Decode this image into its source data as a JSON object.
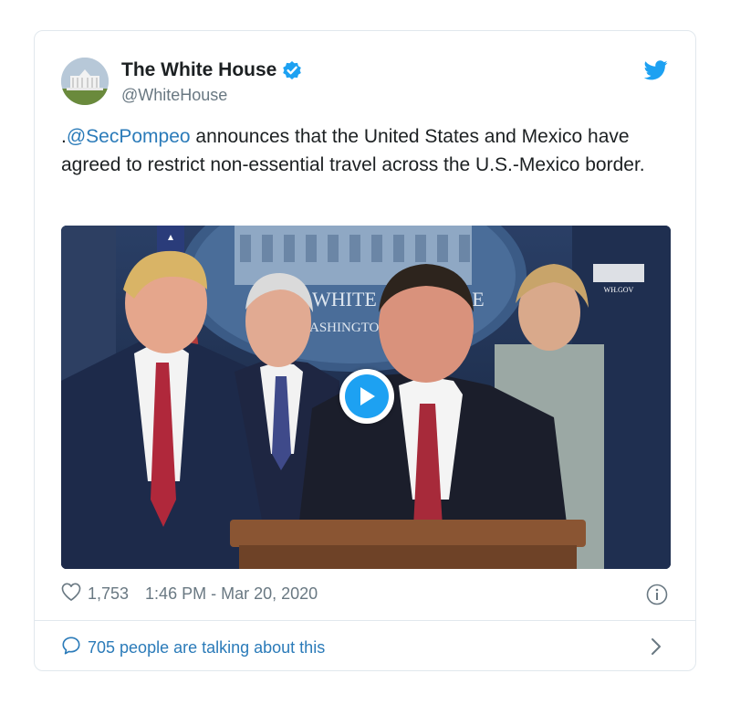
{
  "tweet": {
    "author": {
      "display_name": "The White House",
      "handle": "@WhiteHouse",
      "verified": true
    },
    "text": {
      "prefix": ".",
      "mention": "@SecPompeo",
      "body": " announces that the United States and Mexico have agreed to restrict non-essential travel across the U.S.-Mexico border."
    },
    "media": {
      "type": "video",
      "watermark": "WH.GOV",
      "podium_seal_text": "WHITE HOUSE WASHINGTON"
    },
    "likes": "1,753",
    "timestamp": "1:46 PM - Mar 20, 2020",
    "conversation": "705 people are talking about this"
  },
  "icons": {
    "verified": "verified-badge-icon",
    "twitter": "twitter-bird-icon",
    "play": "play-icon",
    "like": "heart-icon",
    "info": "info-icon",
    "reply": "speech-bubble-icon",
    "chevron": "chevron-right-icon"
  },
  "colors": {
    "link": "#2b7bb9",
    "brand": "#1da1f2",
    "secondary_text": "#697882",
    "border": "#e1e8ed"
  }
}
